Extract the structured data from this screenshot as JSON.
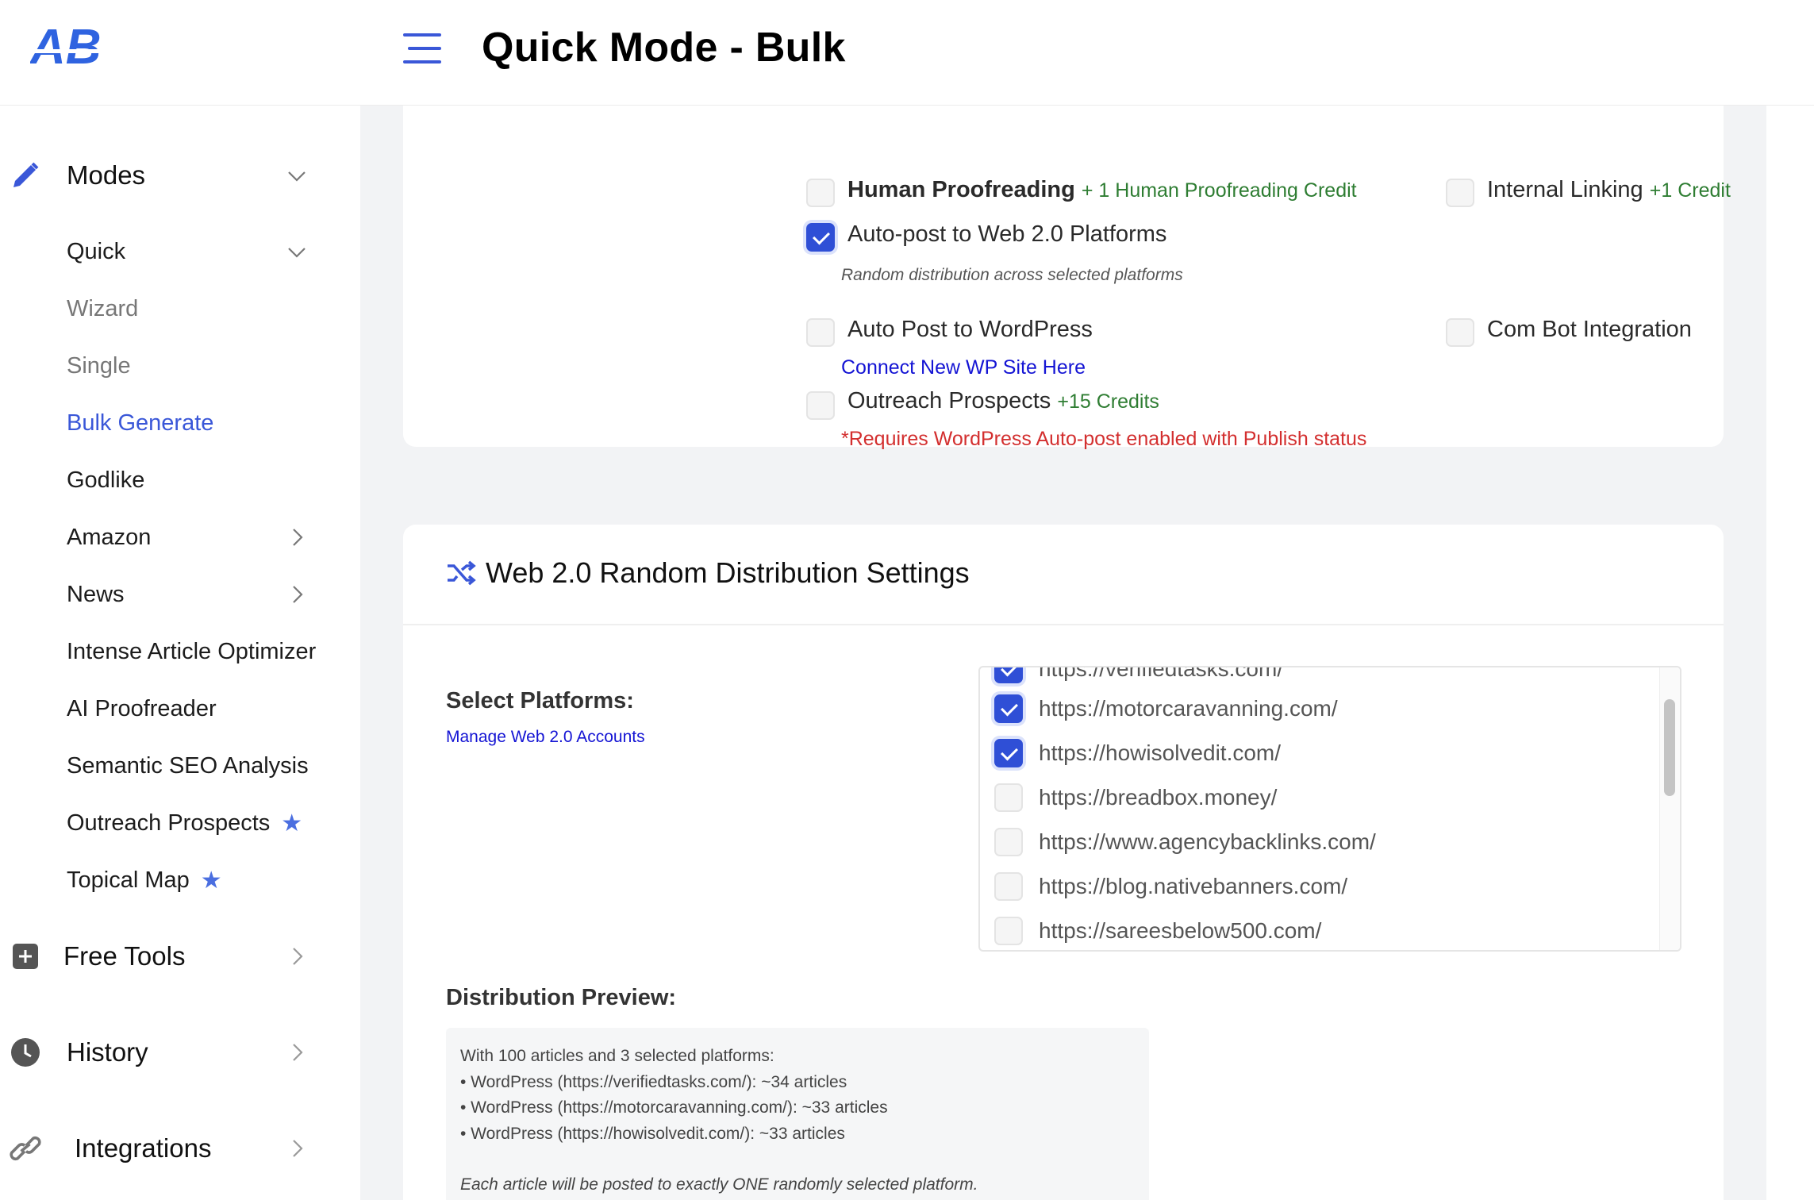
{
  "header": {
    "logo_text": "AB",
    "title": "Quick Mode - Bulk"
  },
  "sidebar": {
    "modes_label": "Modes",
    "sub_items": [
      {
        "label": "Quick",
        "chevron": "down"
      },
      {
        "label": "Wizard"
      },
      {
        "label": "Single"
      },
      {
        "label": "Bulk Generate",
        "active": true
      },
      {
        "label": "Godlike"
      },
      {
        "label": "Amazon",
        "chevron": "right"
      },
      {
        "label": "News",
        "chevron": "right"
      },
      {
        "label": "Intense Article Optimizer"
      },
      {
        "label": "AI Proofreader"
      },
      {
        "label": "Semantic SEO Analysis"
      },
      {
        "label": "Outreach Prospects",
        "star": "★"
      },
      {
        "label": "Topical Map",
        "star": "★"
      }
    ],
    "free_tools_label": "Free Tools",
    "history_label": "History",
    "integrations_label": "Integrations"
  },
  "options": {
    "human_proofreading": {
      "label": "Human Proofreading",
      "credit": "+ 1 Human Proofreading Credit",
      "checked": false
    },
    "internal_linking": {
      "label": "Internal Linking",
      "credit": "+1 Credit",
      "checked": false
    },
    "autopost_web20": {
      "label": "Auto-post to Web 2.0 Platforms",
      "checked": true,
      "hint": "Random distribution across selected platforms"
    },
    "autopost_wp": {
      "label": "Auto Post to WordPress",
      "checked": false,
      "link": "Connect New WP Site Here"
    },
    "com_bot": {
      "label": "Com Bot Integration",
      "checked": false
    },
    "outreach": {
      "label": "Outreach Prospects",
      "credit": "+15 Credits",
      "checked": false,
      "warning": "*Requires WordPress Auto-post enabled with Publish status"
    }
  },
  "web20": {
    "title": "Web 2.0 Random Distribution Settings",
    "select_label": "Select Platforms:",
    "manage_link": "Manage Web 2.0 Accounts",
    "platforms": [
      {
        "url": "https://verifiedtasks.com/",
        "checked": true
      },
      {
        "url": "https://motorcaravanning.com/",
        "checked": true
      },
      {
        "url": "https://howisolvedit.com/",
        "checked": true
      },
      {
        "url": "https://breadbox.money/",
        "checked": false
      },
      {
        "url": "https://www.agencybacklinks.com/",
        "checked": false
      },
      {
        "url": "https://blog.nativebanners.com/",
        "checked": false
      },
      {
        "url": "https://sareesbelow500.com/",
        "checked": false
      }
    ],
    "preview_label": "Distribution Preview:",
    "preview_lines": [
      "With 100 articles and 3 selected platforms:",
      "• WordPress (https://verifiedtasks.com/): ~34 articles",
      "• WordPress (https://motorcaravanning.com/): ~33 articles",
      "• WordPress (https://howisolvedit.com/): ~33 articles"
    ],
    "preview_note": "Each article will be posted to exactly ONE randomly selected platform."
  },
  "colors": {
    "accent": "#2f4fd6",
    "active_nav": "#3a57d8",
    "credit_green": "#2e7d32",
    "warning_red": "#d32f2f",
    "link_blue": "#1414d4"
  }
}
